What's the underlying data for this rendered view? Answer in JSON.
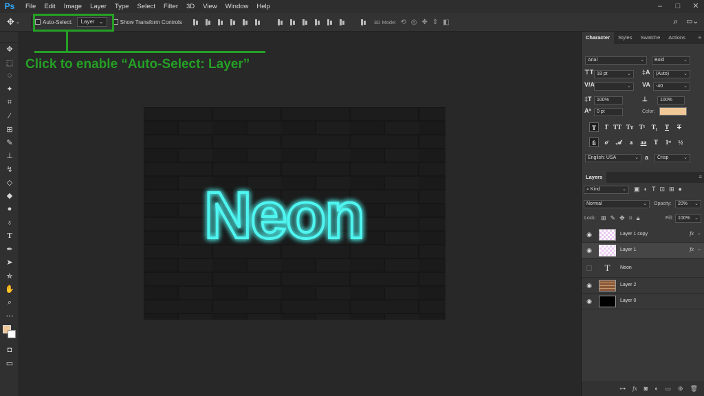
{
  "app": {
    "logo": "Ps"
  },
  "menu": [
    "File",
    "Edit",
    "Image",
    "Layer",
    "Type",
    "Select",
    "Filter",
    "3D",
    "View",
    "Window",
    "Help"
  ],
  "options": {
    "auto_select_label": "Auto-Select:",
    "auto_select_value": "Layer",
    "show_transform_label": "Show Transform Controls",
    "mode_3d_label": "3D Mode:"
  },
  "annotation": {
    "text": "Click to enable “Auto-Select: Layer”",
    "color": "#25a025"
  },
  "canvas": {
    "text": "Neon",
    "glow_color": "#4ff5f0"
  },
  "swatches": {
    "foreground": "#f0c898",
    "background": "#ffffff"
  },
  "character": {
    "tabs": [
      "Character",
      "Styles",
      "Swatche",
      "Actions"
    ],
    "font_family": "Arial",
    "font_style": "Bold",
    "font_size": "18 pt",
    "leading": "(Auto)",
    "kerning": "",
    "tracking": "-40",
    "vertical_scale": "100%",
    "horizontal_scale": "100%",
    "baseline_shift": "0 pt",
    "color_label": "Color:",
    "color": "#f0c898",
    "language": "English: USA",
    "antialias_glyph": "a",
    "antialias_label": "Crisp"
  },
  "layers": {
    "tab": "Layers",
    "filter_kind": "Kind",
    "blend_mode": "Normal",
    "opacity_label": "Opacity:",
    "opacity": "20%",
    "lock_label": "Lock:",
    "fill_label": "Fill:",
    "fill": "100%",
    "items": [
      {
        "name": "Layer 1 copy",
        "visible": true,
        "fx": "fx"
      },
      {
        "name": "Layer 1",
        "visible": true,
        "fx": "fx",
        "selected": true
      },
      {
        "name": "Neon",
        "visible": false,
        "thumb_glyph": "T"
      },
      {
        "name": "Layer 2",
        "visible": true
      },
      {
        "name": "Layer 0",
        "visible": true
      }
    ]
  }
}
